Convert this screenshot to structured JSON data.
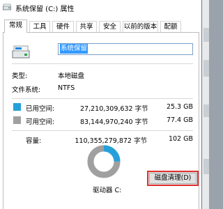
{
  "window": {
    "title": "系统保留 (C:) 属性"
  },
  "tabs": [
    {
      "label": "常规"
    },
    {
      "label": "工具"
    },
    {
      "label": "硬件"
    },
    {
      "label": "共享"
    },
    {
      "label": "安全"
    },
    {
      "label": "以前的版本"
    },
    {
      "label": "配额"
    }
  ],
  "general": {
    "drive_name": "系统保留",
    "type_label": "类型:",
    "type_value": "本地磁盘",
    "fs_label": "文件系统:",
    "fs_value": "NTFS",
    "used": {
      "label": "已用空间:",
      "bytes": "27,210,309,632 字节",
      "size": "25.3 GB",
      "color": "#26a0da"
    },
    "free": {
      "label": "可用空间:",
      "bytes": "83,144,970,240 字节",
      "size": "77.4 GB",
      "color": "#a0a0a0"
    },
    "capacity": {
      "label": "容量:",
      "bytes": "110,355,279,872 字节",
      "size": "102 GB"
    },
    "drive_label": "驱动器 C:",
    "cleanup_label": "磁盘清理(D)"
  }
}
